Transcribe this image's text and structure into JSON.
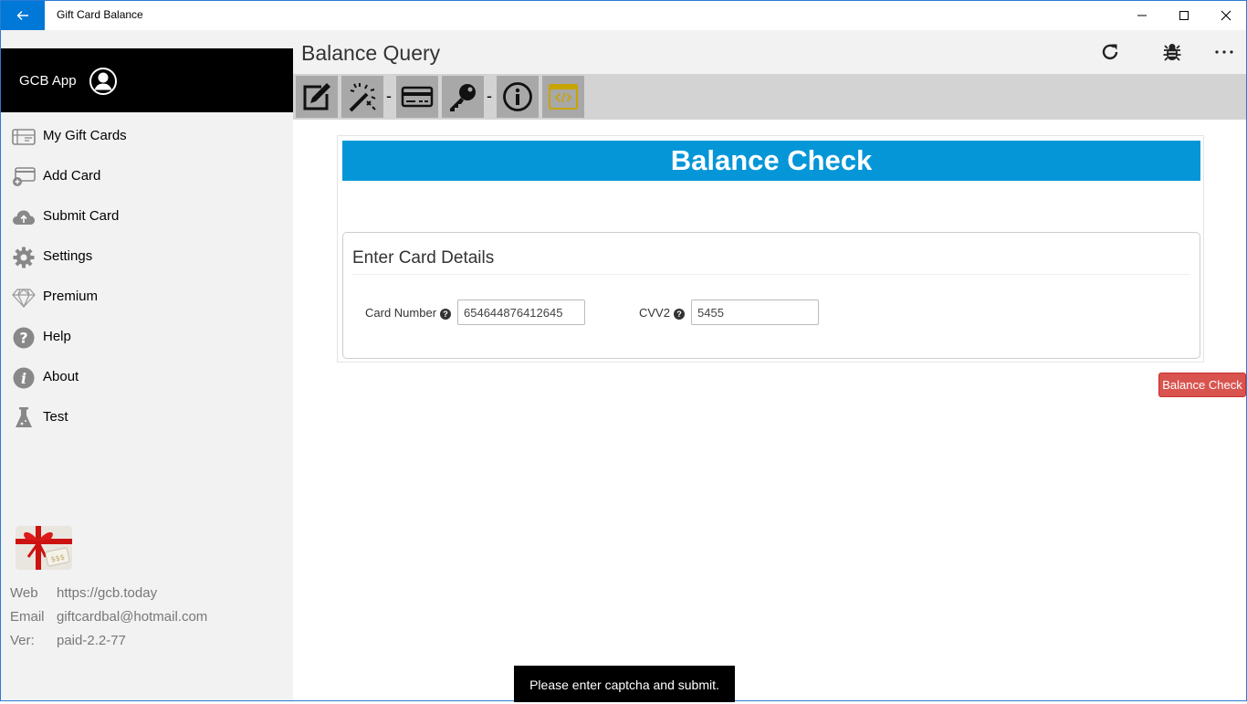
{
  "window": {
    "title": "Gift Card Balance",
    "controls": [
      "minimize-icon",
      "maximize-icon",
      "close-icon"
    ]
  },
  "sidebar": {
    "app_name": "GCB App",
    "items": [
      {
        "label": "My Gift Cards",
        "icon": "gift-card-icon"
      },
      {
        "label": "Add Card",
        "icon": "add-card-icon"
      },
      {
        "label": "Submit Card",
        "icon": "cloud-upload-icon"
      },
      {
        "label": "Settings",
        "icon": "gear-icon"
      },
      {
        "label": "Premium",
        "icon": "diamond-icon"
      },
      {
        "label": "Help",
        "icon": "help-icon"
      },
      {
        "label": "About",
        "icon": "info-icon"
      },
      {
        "label": "Test",
        "icon": "flask-icon"
      }
    ],
    "info": {
      "web_key": "Web",
      "web_value": "https://gcb.today",
      "email_key": "Email",
      "email_value": "giftcardbal@hotmail.com",
      "ver_key": "Ver:",
      "ver_value": "paid-2.2-77"
    }
  },
  "header": {
    "title": "Balance Query",
    "actions": [
      "refresh-icon",
      "bug-icon",
      "more-icon"
    ]
  },
  "toolbar": {
    "buttons": [
      "edit-icon",
      "magic-wand-icon",
      "credit-card-icon",
      "key-icon",
      "info-icon",
      "code-window-icon"
    ],
    "separator": "-"
  },
  "main": {
    "banner": "Balance Check",
    "section_title": "Enter Card Details",
    "card_number_label": "Card Number",
    "card_number_value": "654644876412645",
    "cvv_label": "CVV2",
    "cvv_value": "5455",
    "help_glyph": "?",
    "submit_label": "Balance Check",
    "toast": "Please enter captcha and submit."
  },
  "colors": {
    "accent": "#0078d7",
    "banner": "#0596d8",
    "button_danger": "#d9534f",
    "toolbar_bg": "#d3d3d3",
    "sidebar_bg": "#f2f2f2"
  }
}
